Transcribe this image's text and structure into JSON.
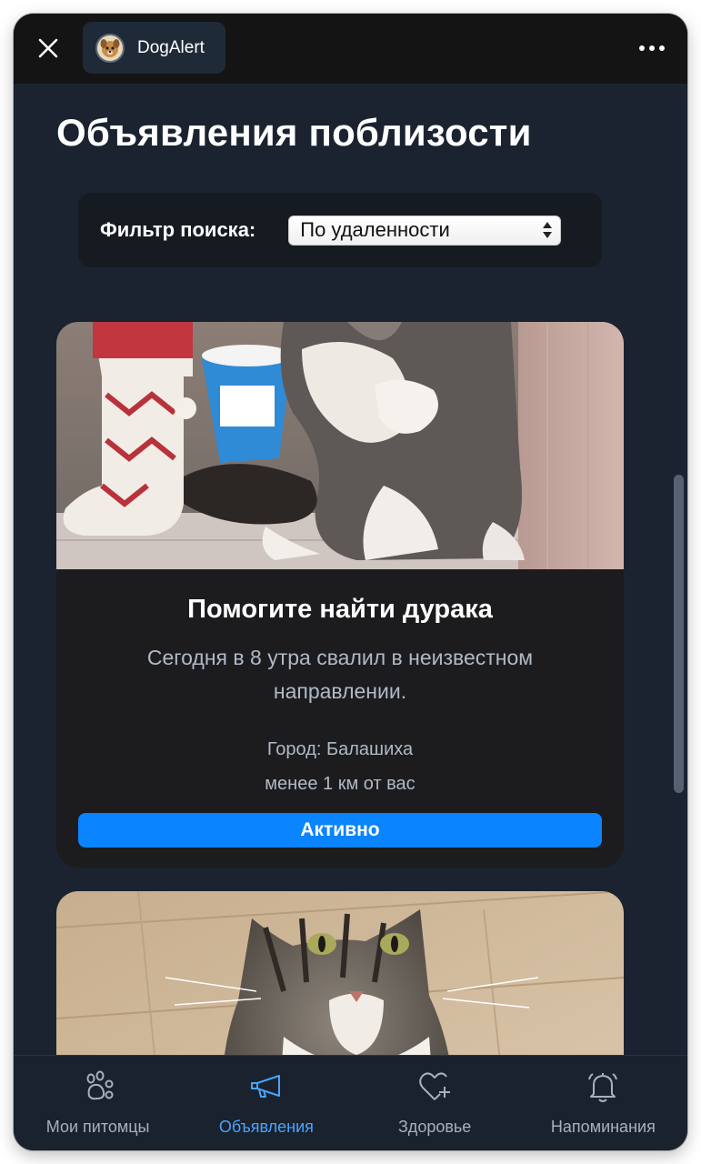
{
  "window": {
    "app_name": "DogAlert",
    "close_icon": "close-icon",
    "more_icon": "more-horizontal-icon"
  },
  "page": {
    "title": "Объявления поблизости"
  },
  "filter": {
    "label": "Фильтр поиска:",
    "selected": "По удаленности"
  },
  "listings": [
    {
      "title": "Помогите найти дурака",
      "description": "Сегодня в 8 утра свалил в неизвестном направлении.",
      "city": "Город: Балашиха",
      "distance": "менее 1 км от вас",
      "status": "Активно"
    }
  ],
  "nav": {
    "items": [
      {
        "label": "Мои питомцы",
        "icon": "paw-icon"
      },
      {
        "label": "Объявления",
        "icon": "megaphone-icon",
        "active": true
      },
      {
        "label": "Здоровье",
        "icon": "heart-plus-icon"
      },
      {
        "label": "Напоминания",
        "icon": "bell-icon"
      }
    ]
  },
  "colors": {
    "accent": "#0a84ff",
    "active_nav": "#4aa3ff",
    "background": "#1b2330",
    "card": "#1c1c1e"
  }
}
